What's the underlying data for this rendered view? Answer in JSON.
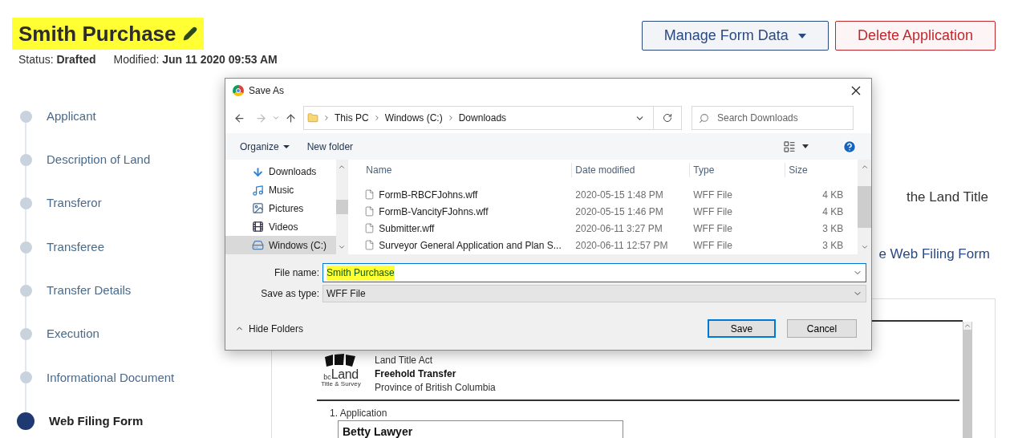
{
  "header": {
    "title": "Smith Purchase",
    "status_label": "Status:",
    "status": "Drafted",
    "modified_label": "Modified:",
    "modified": "Jun 11 2020 09:53 AM"
  },
  "actions": [
    {
      "label": "Manage Form Data",
      "kind": "dropdown"
    },
    {
      "label": "Delete Application",
      "kind": "danger"
    }
  ],
  "steps": [
    {
      "label": "Applicant",
      "selected": false
    },
    {
      "label": "Description of Land",
      "selected": false
    },
    {
      "label": "Transferor",
      "selected": false
    },
    {
      "label": "Transferee",
      "selected": false
    },
    {
      "label": "Transfer Details",
      "selected": false
    },
    {
      "label": "Execution",
      "selected": false
    },
    {
      "label": "Informational Document",
      "selected": false
    },
    {
      "label": "Web Filing Form",
      "selected": true
    }
  ],
  "content": {
    "text": "the Land Title",
    "link": "e Web Filing Form"
  },
  "document": {
    "logo_prefix": "bc",
    "logo_name": "Land",
    "logo_sub": "Title & Survey",
    "act": "Land Title Act",
    "form_title": "Freehold Transfer",
    "province": "Province of British Columbia",
    "section": "1. Application",
    "applicant": "Betty Lawyer"
  },
  "dialog": {
    "title": "Save As",
    "path": [
      "This PC",
      "Windows (C:)",
      "Downloads"
    ],
    "search_placeholder": "Search Downloads",
    "toolbar": [
      "Organize",
      "New folder"
    ],
    "nav": [
      {
        "label": "Downloads",
        "kind": "downloads",
        "selected": false
      },
      {
        "label": "Music",
        "kind": "music",
        "selected": false
      },
      {
        "label": "Pictures",
        "kind": "pictures",
        "selected": false
      },
      {
        "label": "Videos",
        "kind": "videos",
        "selected": false
      },
      {
        "label": "Windows (C:)",
        "kind": "drive",
        "selected": true
      }
    ],
    "columns": [
      "Name",
      "Date modified",
      "Type",
      "Size"
    ],
    "rows": [
      {
        "name": "FormB-RBCFJohns.wff",
        "date": "2020-05-15 1:48 PM",
        "type": "WFF File",
        "size": "4 KB"
      },
      {
        "name": "FormB-VancityFJohns.wff",
        "date": "2020-05-15 1:46 PM",
        "type": "WFF File",
        "size": "4 KB"
      },
      {
        "name": "Submitter.wff",
        "date": "2020-06-11 3:27 PM",
        "type": "WFF File",
        "size": "3 KB"
      },
      {
        "name": "Surveyor General Application and Plan S...",
        "date": "2020-06-11 12:57 PM",
        "type": "WFF File",
        "size": "3 KB"
      }
    ],
    "file_name_label": "File name:",
    "file_name": "Smith Purchase",
    "type_label": "Save as type:",
    "file_type": "WFF File",
    "hide_folders": "Hide Folders",
    "buttons": [
      {
        "label": "Save",
        "kind": "primary"
      },
      {
        "label": "Cancel",
        "kind": "secondary"
      }
    ]
  }
}
